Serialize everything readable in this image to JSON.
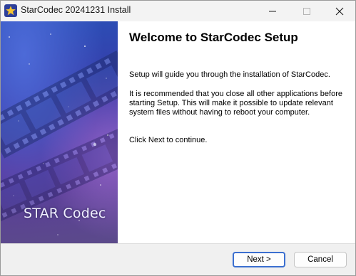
{
  "window": {
    "title": "StarCodec 20241231 Install"
  },
  "banner": {
    "logo_text": "STAR Codec"
  },
  "page": {
    "heading": "Welcome to StarCodec Setup",
    "paragraphs": [
      "Setup will guide you through the installation of StarCodec.",
      "It is recommended that you close all other applications before starting Setup. This will make it possible to update relevant system files without having to reboot your computer.",
      "Click Next to continue."
    ]
  },
  "buttons": {
    "next": "Next >",
    "cancel": "Cancel"
  },
  "icons": {
    "app": "star-app-icon",
    "minimize": "minimize-icon",
    "maximize": "maximize-icon",
    "close": "close-icon"
  },
  "colors": {
    "accent_border": "#3b6fd0",
    "banner_blue": "#2a4fb6",
    "banner_purple": "#5b4a8a"
  }
}
